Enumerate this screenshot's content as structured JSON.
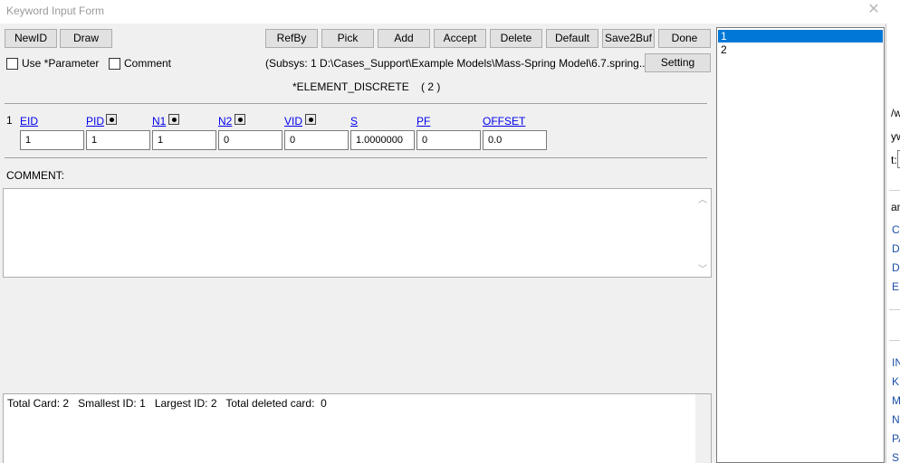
{
  "window": {
    "title": "Keyword Input Form"
  },
  "toolbar": {
    "newid": "NewID",
    "draw": "Draw",
    "refby": "RefBy",
    "pick": "Pick",
    "add": "Add",
    "accept": "Accept",
    "delete": "Delete",
    "default": "Default",
    "save2buf": "Save2Buf",
    "done": "Done",
    "setting": "Setting"
  },
  "options": {
    "use_parameter": {
      "label": "Use *Parameter",
      "checked": false
    },
    "comment": {
      "label": "Comment",
      "checked": false
    }
  },
  "subsys_path": "(Subsys: 1 D:\\Cases_Support\\Example Models\\Mass-Spring Model\\6.7.spring....",
  "keyword": {
    "name": "*ELEMENT_DISCRETE",
    "count": "( 2 )"
  },
  "card": {
    "row_number": "1",
    "fields": [
      {
        "label": "EID",
        "value": "1",
        "has_picker": false
      },
      {
        "label": "PID",
        "value": "1",
        "has_picker": true
      },
      {
        "label": "N1",
        "value": "1",
        "has_picker": true
      },
      {
        "label": "N2",
        "value": "0",
        "has_picker": true
      },
      {
        "label": "VID",
        "value": "0",
        "has_picker": true
      },
      {
        "label": "S",
        "value": "1.0000000",
        "has_picker": false
      },
      {
        "label": "PF",
        "value": "0",
        "has_picker": false
      },
      {
        "label": "OFFSET",
        "value": "0.0",
        "has_picker": false
      }
    ]
  },
  "comment_section": {
    "label": "COMMENT:",
    "value": ""
  },
  "status": {
    "total_card_label": "Total Card:",
    "total_card": "2",
    "smallest_id_label": "Smallest ID:",
    "smallest_id": "1",
    "largest_id_label": "Largest ID:",
    "largest_id": "2",
    "total_deleted_label": "Total deleted card:",
    "total_deleted": "0"
  },
  "id_list": {
    "items": [
      "1",
      "2"
    ],
    "selected": "1"
  },
  "background_window": {
    "fragments": [
      "/w",
      "yw",
      "t:",
      "am"
    ],
    "links": [
      "C(",
      "DA",
      "DE",
      "EL",
      "IN",
      "KE",
      "M",
      "N",
      "PA",
      "SE"
    ]
  }
}
